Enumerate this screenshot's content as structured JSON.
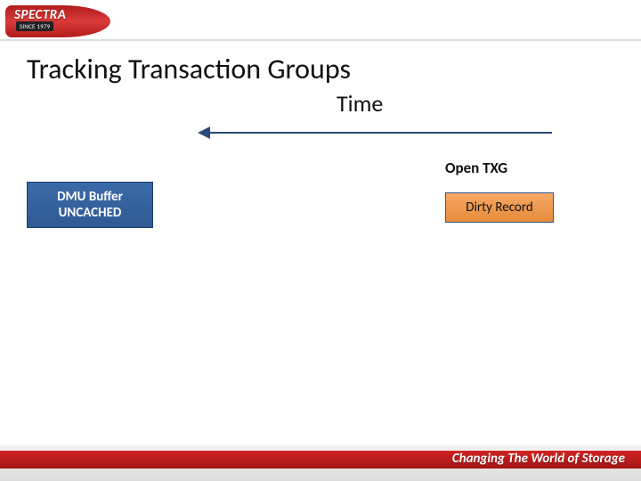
{
  "logo": {
    "brand": "SPECTRA",
    "since": "SINCE 1979"
  },
  "title": "Tracking Transaction Groups",
  "timeline": {
    "label": "Time"
  },
  "open_txg_label": "Open TXG",
  "dmu_box": {
    "line1": "DMU Buffer",
    "line2": "UNCACHED"
  },
  "dirty_box": {
    "label": "Dirty Record"
  },
  "footer": {
    "tagline": "Changing The World of Storage"
  }
}
